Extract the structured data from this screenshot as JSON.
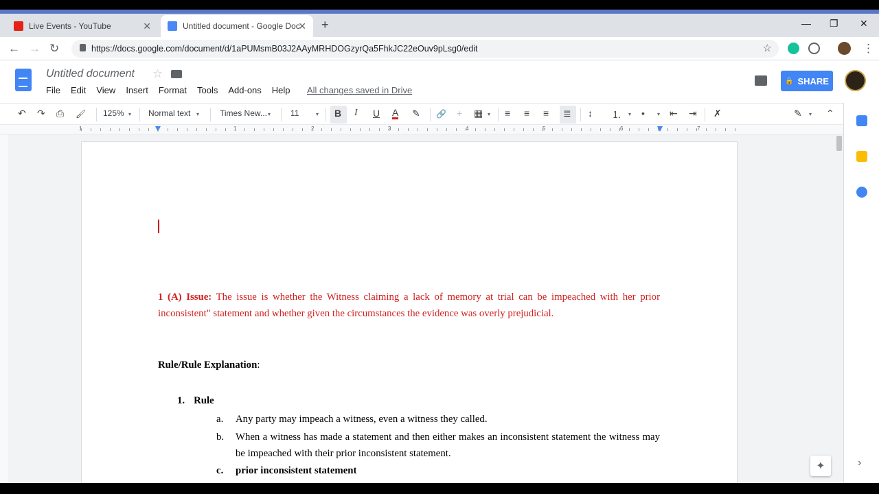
{
  "browser": {
    "tabs": [
      {
        "title": "Live Events - YouTube",
        "favicon": "youtube-icon",
        "active": false
      },
      {
        "title": "Untitled document - Google Doc",
        "favicon": "google-docs-icon",
        "active": true
      }
    ],
    "url": "https://docs.google.com/document/d/1aPUMsmB03J2AAyMRHDOGzyrQa5FhkJC22eOuv9pLsg0/edit",
    "close_glyph": "✕",
    "new_tab_glyph": "+",
    "nav": {
      "back": "←",
      "forward": "→",
      "reload": "↻"
    },
    "window": {
      "minimize": "—",
      "maximize": "❐",
      "close": "✕"
    },
    "bookmark_glyph": "☆",
    "menu_glyph": "⋮"
  },
  "docs": {
    "title": "Untitled document",
    "title_star": "☆",
    "menu": [
      "File",
      "Edit",
      "View",
      "Insert",
      "Format",
      "Tools",
      "Add-ons",
      "Help"
    ],
    "save_status": "All changes saved in Drive",
    "share_label": "SHARE",
    "share_lock": "🔒"
  },
  "toolbar": {
    "undo": "↶",
    "redo": "↷",
    "print": "⎙",
    "paint_format": "🖌",
    "zoom": "125%",
    "style": "Normal text",
    "font": "Times New...",
    "font_size": "11",
    "bold": "B",
    "italic": "I",
    "underline": "U",
    "text_color": "A",
    "highlight": "✎",
    "link": "🔗",
    "comment": "+",
    "image": "▦",
    "align_left": "≡",
    "align_center": "≡",
    "align_right": "≡",
    "justify": "≣",
    "line_spacing": "↕",
    "numbered_list": "⒈",
    "bulleted_list": "•",
    "indent_decrease": "⇤",
    "indent_increase": "⇥",
    "clear_format": "✗",
    "edit_mode": "✎",
    "collapse": "⌃",
    "caret": "▾"
  },
  "ruler": {
    "numbers": [
      "1",
      "1",
      "2",
      "3",
      "4",
      "5",
      "6",
      "7"
    ]
  },
  "document": {
    "issue_label": "1 (A) Issue:",
    "issue_text": " The issue is whether the Witness claiming a lack of memory at trial can be impeached with her prior inconsistent\" statement and whether given the circumstances the evidence was overly prejudicial.",
    "rule_heading": "Rule/Rule Explanation",
    "rule_heading_colon": ":",
    "item1_marker": "1.",
    "item1_label": "Rule",
    "sub_a_marker": "a.",
    "sub_a_text": "Any party may impeach a witness, even a witness they called.",
    "sub_b_marker": "b.",
    "sub_b_text": "When a witness has made a statement and then either makes an inconsistent statement the witness may be impeached with their prior inconsistent statement.",
    "sub_c_marker": "c.",
    "sub_c_text": "prior inconsistent statement"
  },
  "side_panel": {
    "explore_glyph": "✦",
    "expand_glyph": "›"
  },
  "colors": {
    "issue_red": "#d11f1f",
    "share_blue": "#4285f4",
    "docs_blue": "#4285f4"
  }
}
